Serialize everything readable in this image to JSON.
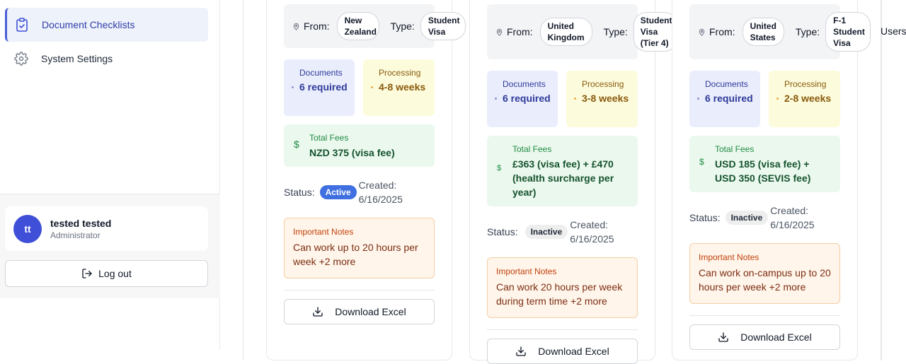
{
  "sidebar": {
    "items": [
      {
        "label": "Document Checklists",
        "icon": "clipboard-check-icon",
        "active": true
      },
      {
        "label": "System Settings",
        "icon": "gear-icon",
        "active": false
      }
    ],
    "user": {
      "initials": "tt",
      "name": "tested tested",
      "role": "Administrator"
    },
    "logout_label": "Log out"
  },
  "cards": [
    {
      "from_label": "From:",
      "from_value": "New Zealand",
      "type_label": "Type:",
      "type_value": "Student Visa",
      "docs_caption": "Documents",
      "docs_value": "6 required",
      "proc_caption": "Processing",
      "proc_value": "4-8 weeks",
      "fees_caption": "Total Fees",
      "fees_value": "NZD 375 (visa fee)",
      "status_label": "Status:",
      "status_value": "Active",
      "created": "Created: 6/16/2025",
      "notes_caption": "Important Notes",
      "notes_text": "Can work up to 20 hours per week +2 more",
      "download_label": "Download Excel"
    },
    {
      "from_label": "From:",
      "from_value": "United Kingdom",
      "type_label": "Type:",
      "type_value": "Student Visa (Tier 4)",
      "docs_caption": "Documents",
      "docs_value": "6 required",
      "proc_caption": "Processing",
      "proc_value": "3-8 weeks",
      "fees_caption": "Total Fees",
      "fees_value": "£363 (visa fee) + £470 (health surcharge per year)",
      "status_label": "Status:",
      "status_value": "Inactive",
      "created": "Created: 6/16/2025",
      "notes_caption": "Important Notes",
      "notes_text": "Can work 20 hours per week during term time +2 more",
      "download_label": "Download Excel"
    },
    {
      "from_label": "From:",
      "from_value": "United States",
      "type_label": "Type:",
      "type_value": "F-1 Student Visa",
      "docs_caption": "Documents",
      "docs_value": "6 required",
      "proc_caption": "Processing",
      "proc_value": "2-8 weeks",
      "fees_caption": "Total Fees",
      "fees_value": "USD 185 (visa fee) + USD 350 (SEVIS fee)",
      "status_label": "Status:",
      "status_value": "Inactive",
      "created": "Created: 6/16/2025",
      "notes_caption": "Important Notes",
      "notes_text": "Can work on-campus up to 20 hours per week +2 more",
      "download_label": "Download Excel"
    }
  ],
  "cut_off_label": "Users"
}
